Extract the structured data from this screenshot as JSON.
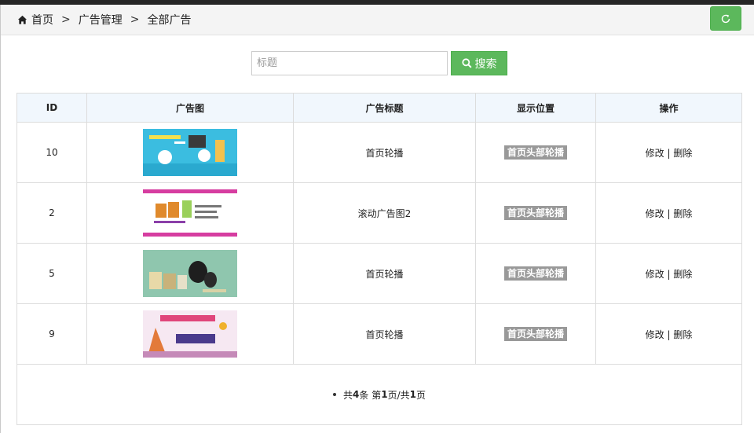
{
  "breadcrumb": {
    "home": "首页",
    "sep1": ">",
    "level2": "广告管理",
    "sep2": ">",
    "level3": "全部广告"
  },
  "search": {
    "placeholder": "标题",
    "value": "",
    "button_label": "搜索"
  },
  "table": {
    "headers": [
      "ID",
      "广告图",
      "广告标题",
      "显示位置",
      "操作"
    ],
    "rows": [
      {
        "id": "10",
        "title": "首页轮播",
        "position": "首页头部轮播",
        "edit": "修改",
        "sep": "|",
        "delete": "删除"
      },
      {
        "id": "2",
        "title": "滚动广告图2",
        "position": "首页头部轮播",
        "edit": "修改",
        "sep": "|",
        "delete": "删除"
      },
      {
        "id": "5",
        "title": "首页轮播",
        "position": "首页头部轮播",
        "edit": "修改",
        "sep": "|",
        "delete": "删除"
      },
      {
        "id": "9",
        "title": "首页轮播",
        "position": "首页头部轮播",
        "edit": "修改",
        "sep": "|",
        "delete": "删除"
      }
    ]
  },
  "pager": {
    "prefix": "共",
    "count": "4",
    "mid1": "条 第",
    "page": "1",
    "mid2": "页/共",
    "pages": "1",
    "suffix": "页"
  },
  "colors": {
    "accent_green": "#5cb85c",
    "header_bg": "#f1f7fd",
    "badge_bg": "#999999"
  }
}
